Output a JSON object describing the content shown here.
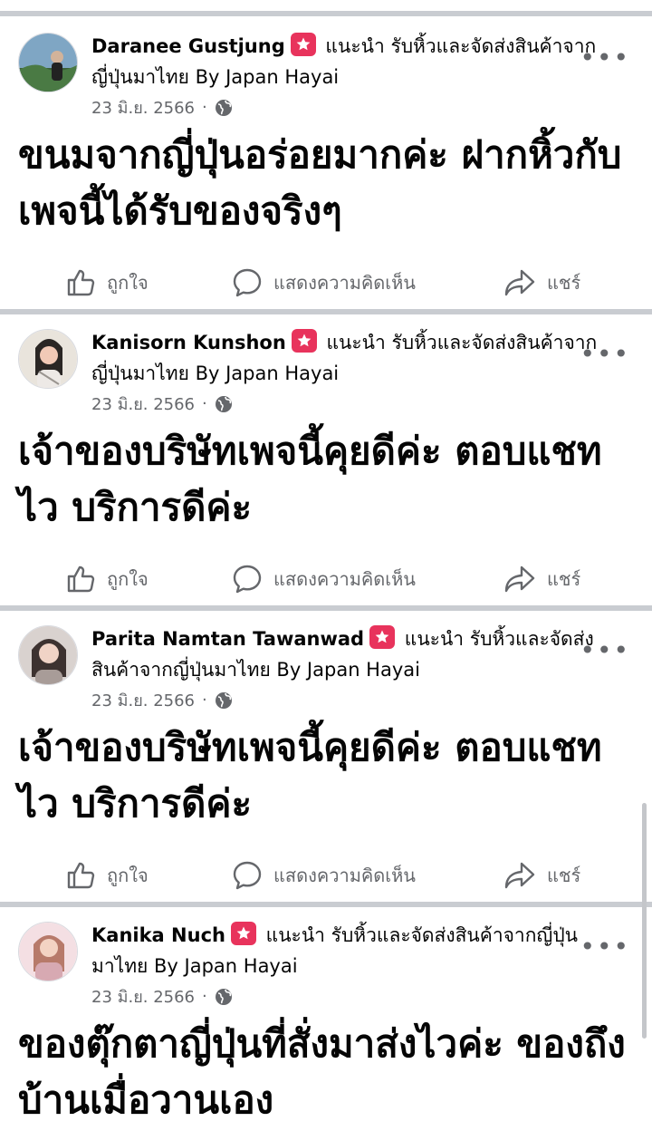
{
  "posts": [
    {
      "author": "Daranee Gustjung",
      "verb": "แนะนำ",
      "page": "รับหิ้วและจัดส่งสินค้าจากญี่ปุ่นมาไทย By Japan Hayai",
      "date": "23 มิ.ย. 2566",
      "text": "ขนมจากญี่ปุ่นอร่อยมากค่ะ ฝากหิ้วกับเพจนี้ได้รับของจริงๆ",
      "avatar_colors": [
        "#7fa6c4",
        "#3b5f3a",
        "#d2b39a"
      ]
    },
    {
      "author": "Kanisorn Kunshon",
      "verb": "แนะนำ",
      "page": "รับหิ้วและจัดส่งสินค้าจากญี่ปุ่นมาไทย By Japan Hayai",
      "date": "23 มิ.ย. 2566",
      "text": "เจ้าของบริษัทเพจนี้คุยดีค่ะ ตอบแชทไว บริการดีค่ะ",
      "avatar_colors": [
        "#e9e4dc",
        "#2a2624",
        "#f1c9b6"
      ]
    },
    {
      "author": "Parita Namtan Tawanwad",
      "verb": "แนะนำ",
      "page": "รับหิ้วและจัดส่งสินค้าจากญี่ปุ่นมาไทย By Japan Hayai",
      "date": "23 มิ.ย. 2566",
      "text": "เจ้าของบริษัทเพจนี้คุยดีค่ะ ตอบแชทไว บริการดีค่ะ",
      "avatar_colors": [
        "#d9d2cf",
        "#3d3230",
        "#f0d3c6"
      ]
    },
    {
      "author": "Kanika Nuch",
      "verb": "แนะนำ",
      "page": "รับหิ้วและจัดส่งสินค้าจากญี่ปุ่นมาไทย By Japan Hayai",
      "date": "23 มิ.ย. 2566",
      "text": "ของตุ๊กตาญี่ปุ่นที่สั่งมาส่งไวค่ะ ของถึงบ้านเมื่อวานเอง",
      "avatar_colors": [
        "#f4dfe3",
        "#d7a9b2",
        "#f3d3c3"
      ]
    }
  ],
  "actions": {
    "like": "ถูกใจ",
    "comment": "แสดงความคิดเห็น",
    "share": "แชร์"
  },
  "icons": {
    "badge": "recommend-star-icon",
    "audience": "globe-icon",
    "more": "more-options-icon"
  },
  "colors": {
    "badge": "#e8335c",
    "divider": "#c9ccd1",
    "secondary_text": "#65676b"
  }
}
